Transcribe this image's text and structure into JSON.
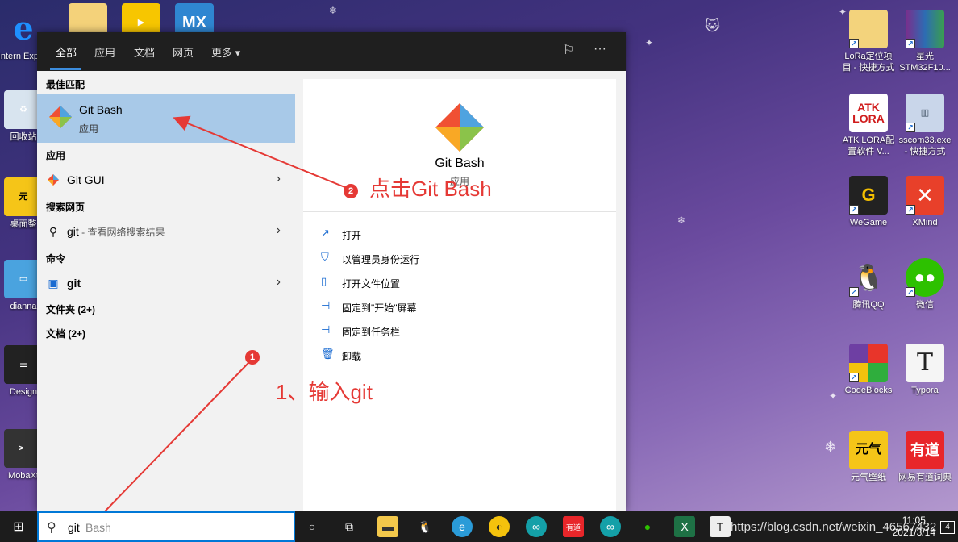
{
  "panel": {
    "tabs": [
      "全部",
      "应用",
      "文档",
      "网页",
      "更多"
    ],
    "best_match_header": "最佳匹配",
    "best_match": {
      "name": "Git Bash",
      "type": "应用"
    },
    "apps_header": "应用",
    "apps": [
      {
        "name": "Git GUI"
      }
    ],
    "web_header": "搜索网页",
    "web": {
      "term": "git",
      "suffix": " - 查看网络搜索结果"
    },
    "cmd_header": "命令",
    "cmd": {
      "name": "git"
    },
    "folders": "文件夹 (2+)",
    "docs": "文档 (2+)",
    "detail": {
      "name": "Git Bash",
      "type": "应用",
      "actions": [
        "打开",
        "以管理员身份运行",
        "打开文件位置",
        "固定到\"开始\"屏幕",
        "固定到任务栏",
        "卸载"
      ]
    }
  },
  "annotations": {
    "step1_badge": "1",
    "step1_text": "1、输入git",
    "step2_badge": "2",
    "step2_text": "点击Git Bash",
    "color": "#e53935"
  },
  "taskbar": {
    "search_value": "git",
    "search_placeholder": "Bash",
    "time": "11:05",
    "date": "2021/3/14",
    "notification_count": "4",
    "watermark": "https://blog.csdn.net/weixin_46567432"
  },
  "desktop": {
    "left_icons": [
      "Intern Explor",
      "回收站",
      "桌面整",
      "dianna",
      "Design",
      "MobaXt"
    ],
    "top_icons": [
      "MX"
    ],
    "right_icons": [
      {
        "label": "LoRa定位项目 - 快捷方式",
        "icon": "folder-icon"
      },
      {
        "label": "星光 STM32F10...",
        "icon": "winrar-icon"
      },
      {
        "label": "ATK LORA配置软件 V...",
        "icon": "atk-lora-icon",
        "tile_text": "ATK LORA"
      },
      {
        "label": "sscom33.exe - 快捷方式",
        "icon": "building-icon"
      },
      {
        "label": "WeGame",
        "icon": "wegame-icon"
      },
      {
        "label": "XMind",
        "icon": "xmind-icon"
      },
      {
        "label": "腾讯QQ",
        "icon": "qq-icon"
      },
      {
        "label": "微信",
        "icon": "wechat-icon"
      },
      {
        "label": "CodeBlocks",
        "icon": "codeblocks-icon"
      },
      {
        "label": "Typora",
        "icon": "typora-icon",
        "tile_text": "T"
      },
      {
        "label": "元气壁纸",
        "icon": "yuanqi-icon",
        "tile_text": "元气"
      },
      {
        "label": "网易有道词典",
        "icon": "youdao-icon",
        "tile_text": "有道"
      }
    ]
  }
}
